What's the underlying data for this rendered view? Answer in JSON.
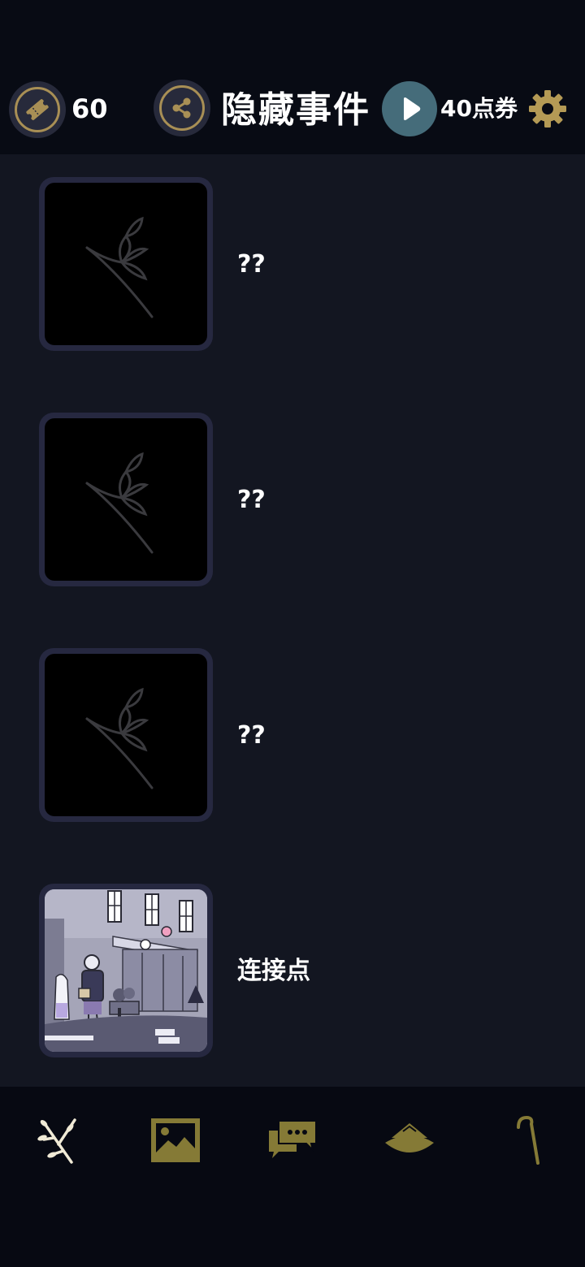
{
  "header": {
    "ticket_count": "60",
    "title": "隐藏事件",
    "voucher_label": "40点券"
  },
  "events": [
    {
      "label": "??",
      "locked": true
    },
    {
      "label": "??",
      "locked": true
    },
    {
      "label": "??",
      "locked": true
    },
    {
      "label": "连接点",
      "locked": false
    }
  ],
  "bottom_nav": [
    {
      "icon": "sprig-icon",
      "active": true
    },
    {
      "icon": "picture-icon",
      "active": false
    },
    {
      "icon": "chat-bubbles-icon",
      "active": false
    },
    {
      "icon": "hat-icon",
      "active": false
    },
    {
      "icon": "cane-icon",
      "active": false
    }
  ],
  "colors": {
    "background": "#131621",
    "topbar": "#080b14",
    "gold": "#a88f55",
    "olive": "#857a36",
    "play": "#456c7a"
  }
}
